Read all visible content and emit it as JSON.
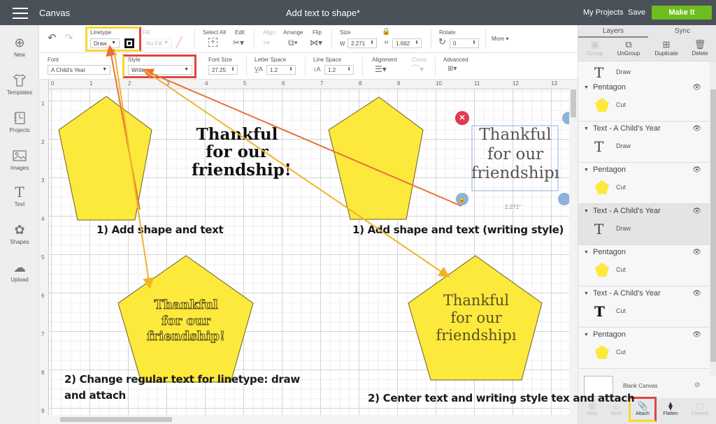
{
  "topbar": {
    "menu_icon": "hamburger-icon",
    "app_title": "Canvas",
    "doc_title": "Add text to shape*",
    "my_projects": "My Projects",
    "save": "Save",
    "make_it": "Make It",
    "make_it_color": "#6ebd1e"
  },
  "leftnav": [
    {
      "label": "New",
      "icon": "plus-circle-icon",
      "glyph": "⊕"
    },
    {
      "label": "Templates",
      "icon": "tshirt-icon",
      "glyph": "👕"
    },
    {
      "label": "Projects",
      "icon": "notebook-icon",
      "glyph": "▤"
    },
    {
      "label": "Images",
      "icon": "image-icon",
      "glyph": "🖼"
    },
    {
      "label": "Text",
      "icon": "text-icon",
      "glyph": "T"
    },
    {
      "label": "Shapes",
      "icon": "shapes-icon",
      "glyph": "✿"
    },
    {
      "label": "Upload",
      "icon": "cloud-upload-icon",
      "glyph": "☁"
    }
  ],
  "toolbar1": {
    "undo": "↶",
    "redo": "↷",
    "linetype_label": "Linetype",
    "linetype_value": "Draw",
    "fill_label": "Fill",
    "fill_value": "No Fill",
    "select_all": "Select All",
    "edit": "Edit",
    "align": "Align",
    "arrange": "Arrange",
    "flip": "Flip",
    "size": "Size",
    "w_label": "W",
    "w_value": "2.271",
    "h_label": "H",
    "h_value": "1.692",
    "rotate": "Rotate",
    "rotate_value": "0",
    "more": "More ▾"
  },
  "toolbar2": {
    "font_label": "Font",
    "font_value": "A Child's Year",
    "style_label": "Style",
    "style_value": "Writing",
    "font_size_label": "Font Size",
    "font_size_value": "27.25",
    "letter_space_label": "Letter Space",
    "letter_space_value": "1.2",
    "line_space_label": "Line Space",
    "line_space_value": "1.2",
    "alignment_label": "Alignment",
    "curve_label": "Curve",
    "advanced_label": "Advanced"
  },
  "ruler": {
    "top": [
      "0",
      "1",
      "2",
      "3",
      "4",
      "5",
      "6",
      "7",
      "8",
      "9",
      "10",
      "11",
      "12",
      "13"
    ],
    "left": [
      "1",
      "2",
      "3",
      "4",
      "5",
      "6",
      "7",
      "8",
      "9"
    ]
  },
  "canvas": {
    "shape_color": "#fde93c",
    "text_lines": [
      "Thankful",
      "for our",
      "friendship!"
    ],
    "text_lines_writing": [
      "Thankful",
      "for our",
      "friendshipı"
    ],
    "size_readout": "2.271\"",
    "annotations": {
      "a1": "1) Add shape and text",
      "a2": "1) Add shape and text (writing style)",
      "a3_l1": "2) Change regular text for linetype: draw",
      "a3_l2": "and attach",
      "a4": "2) Center text and writing style tex and attach"
    }
  },
  "panel": {
    "tabs": [
      "Layers",
      "Sync"
    ],
    "tools": [
      "Group",
      "UnGroup",
      "Duplicate",
      "Delete"
    ],
    "layers": [
      {
        "name": "",
        "op": "Draw",
        "icon": "text-draw-icon"
      },
      {
        "name": "Pentagon",
        "op": "Cut",
        "icon": "pentagon-icon"
      },
      {
        "name": "Text - A Child's Year",
        "op": "Draw",
        "icon": "text-icon"
      },
      {
        "name": "Pentagon",
        "op": "Cut",
        "icon": "pentagon-icon"
      },
      {
        "name": "Text - A Child's Year",
        "op": "Draw",
        "icon": "text-icon"
      },
      {
        "name": "Pentagon",
        "op": "Cut",
        "icon": "pentagon-icon"
      },
      {
        "name": "Text - A Child's Year",
        "op": "Cut",
        "icon": "text-bold-icon"
      },
      {
        "name": "Pentagon",
        "op": "Cut",
        "icon": "pentagon-icon"
      }
    ],
    "blank_canvas": "Blank Canvas",
    "bottom": [
      "Slice",
      "Weld",
      "Attach",
      "Flatten",
      "Contour"
    ]
  }
}
